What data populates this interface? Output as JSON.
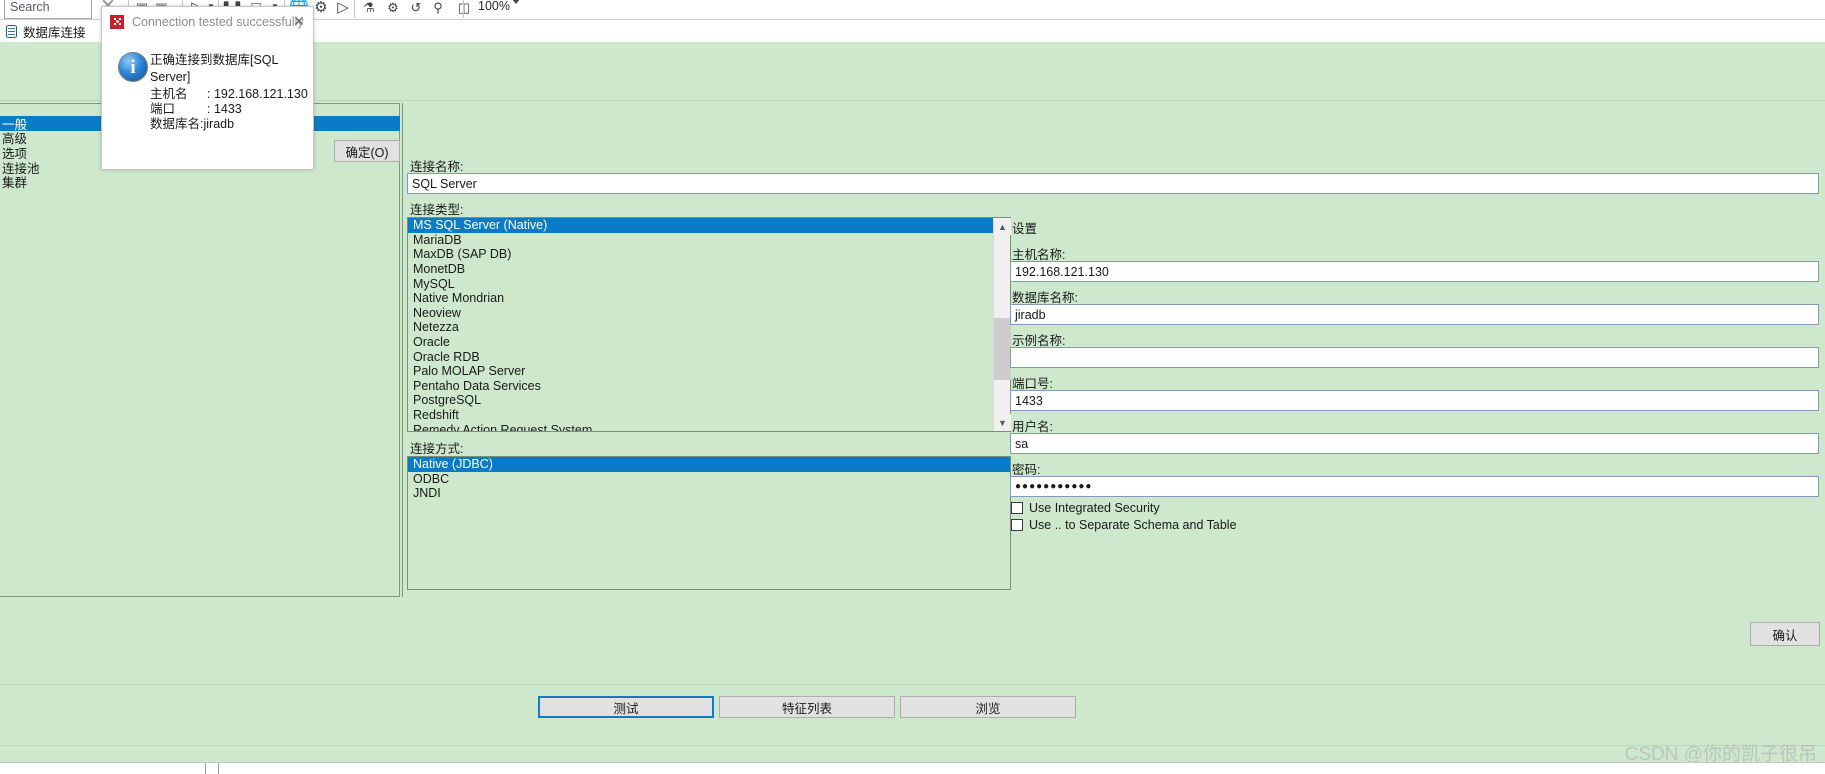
{
  "toolbar": {
    "search_placeholder": "Search",
    "zoom_level": "100%",
    "icons": [
      "save-icon",
      "save-as-icon",
      "transform-icon",
      "pause-icon",
      "stop-icon",
      "preview-icon",
      "globe-icon",
      "gear-run-icon",
      "run-icon",
      "sql-icon",
      "debug-icon",
      "replay-icon",
      "inspect-icon",
      "grid-icon"
    ]
  },
  "tab": {
    "label": "数据库连接",
    "icon": "database-icon"
  },
  "sidebar": {
    "items": [
      {
        "label": "一般",
        "selected": true
      },
      {
        "label": "高级",
        "selected": false
      },
      {
        "label": "选项",
        "selected": false
      },
      {
        "label": "连接池",
        "selected": false
      },
      {
        "label": "集群",
        "selected": false
      }
    ]
  },
  "form": {
    "connection_name_label": "连接名称:",
    "connection_name_value": "SQL Server",
    "connection_type_label": "连接类型:",
    "connection_types": [
      "MS SQL Server (Native)",
      "MariaDB",
      "MaxDB (SAP DB)",
      "MonetDB",
      "MySQL",
      "Native Mondrian",
      "Neoview",
      "Netezza",
      "Oracle",
      "Oracle RDB",
      "Palo MOLAP Server",
      "Pentaho Data Services",
      "PostgreSQL",
      "Redshift",
      "Remedy Action Request System"
    ],
    "connection_type_selected": "MS SQL Server (Native)",
    "access_label": "连接方式:",
    "access_methods": [
      "Native (JDBC)",
      "ODBC",
      "JNDI"
    ],
    "access_selected": "Native (JDBC)"
  },
  "settings": {
    "title": "设置",
    "fields": [
      {
        "label": "主机名称:",
        "value": "192.168.121.130",
        "name": "host-name"
      },
      {
        "label": "数据库名称:",
        "value": "jiradb",
        "name": "database-name"
      },
      {
        "label": "示例名称:",
        "value": "",
        "name": "instance-name"
      },
      {
        "label": "端口号:",
        "value": "1433",
        "name": "port-number"
      },
      {
        "label": "用户名:",
        "value": "sa",
        "name": "user-name"
      },
      {
        "label": "密码:",
        "value": "●●●●●●●●●●●",
        "name": "password"
      }
    ],
    "checkboxes": [
      {
        "label": "Use Integrated Security",
        "checked": false
      },
      {
        "label": "Use .. to Separate Schema and Table",
        "checked": false
      }
    ]
  },
  "buttons": {
    "test": "测试",
    "feature_list": "特征列表",
    "explore": "浏览",
    "confirm": "确认"
  },
  "dialog": {
    "title": "Connection tested successfully",
    "close_icon": "close-icon",
    "info_icon": "info-icon",
    "message": "正确连接到数据库[SQL Server]",
    "rows": [
      {
        "key": "主机名",
        "value": ": 192.168.121.130"
      },
      {
        "key": "端口",
        "value": ": 1433"
      }
    ],
    "db_row": "数据库名:jiradb",
    "ok_label": "确定(O)"
  },
  "watermark": "CSDN @你的凯子很吊",
  "colors": {
    "accent_blue": "#0a7cc7",
    "body_green": "#cde8cd",
    "dialog_red": "#c8202a",
    "button_face": "#e1e1e1"
  }
}
